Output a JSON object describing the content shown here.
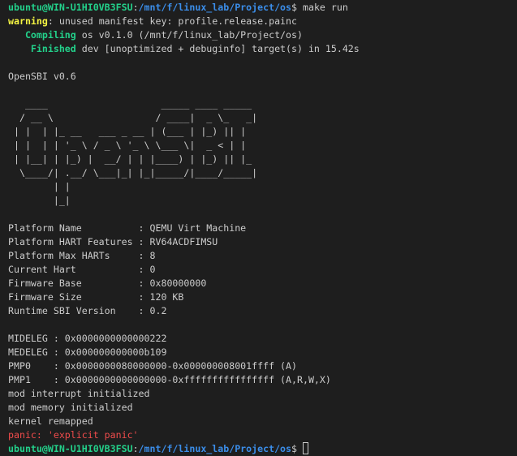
{
  "prompt": {
    "user_host": "ubuntu@WIN-U1HI0VB3FSU",
    "path": "/mnt/f/linux_lab/Project/os",
    "symbol": "$",
    "command": "make run"
  },
  "warning": {
    "label": "warning",
    "text": ": unused manifest key: profile.release.painc"
  },
  "compiling": {
    "label": "   Compiling",
    "text": " os v0.1.0 (/mnt/f/linux_lab/Project/os)"
  },
  "finished": {
    "label": "    Finished",
    "text": " dev [unoptimized + debuginfo] target(s) in 15.42s"
  },
  "opensbi_version": "OpenSBI v0.6",
  "logo": [
    "   ____                    _____ ____ _____",
    "  / __ \\                  / ____|  _ \\_   _|",
    " | |  | |_ __   ___ _ __ | (___ | |_) || |",
    " | |  | | '_ \\ / _ \\ '_ \\ \\___ \\|  _ < | |",
    " | |__| | |_) |  __/ | | |____) | |_) || |_",
    "  \\____/| .__/ \\___|_| |_|_____/|____/_____|",
    "        | |",
    "        |_|"
  ],
  "platform": [
    "Platform Name          : QEMU Virt Machine",
    "Platform HART Features : RV64ACDFIMSU",
    "Platform Max HARTs     : 8",
    "Current Hart           : 0",
    "Firmware Base          : 0x80000000",
    "Firmware Size          : 120 KB",
    "Runtime SBI Version    : 0.2"
  ],
  "registers": [
    "MIDELEG : 0x0000000000000222",
    "MEDELEG : 0x000000000000b109",
    "PMP0    : 0x0000000080000000-0x000000008001ffff (A)",
    "PMP1    : 0x0000000000000000-0xffffffffffffffff (A,R,W,X)"
  ],
  "kernel_log": [
    "mod interrupt initialized",
    "mod memory initialized",
    "kernel remapped"
  ],
  "panic": "panic: 'explicit panic'",
  "colors": {
    "background": "#1e1e1e",
    "text": "#cccccc",
    "green": "#23d18b",
    "blue": "#3b8eea",
    "yellow": "#f5f543",
    "red": "#f14c4c"
  }
}
